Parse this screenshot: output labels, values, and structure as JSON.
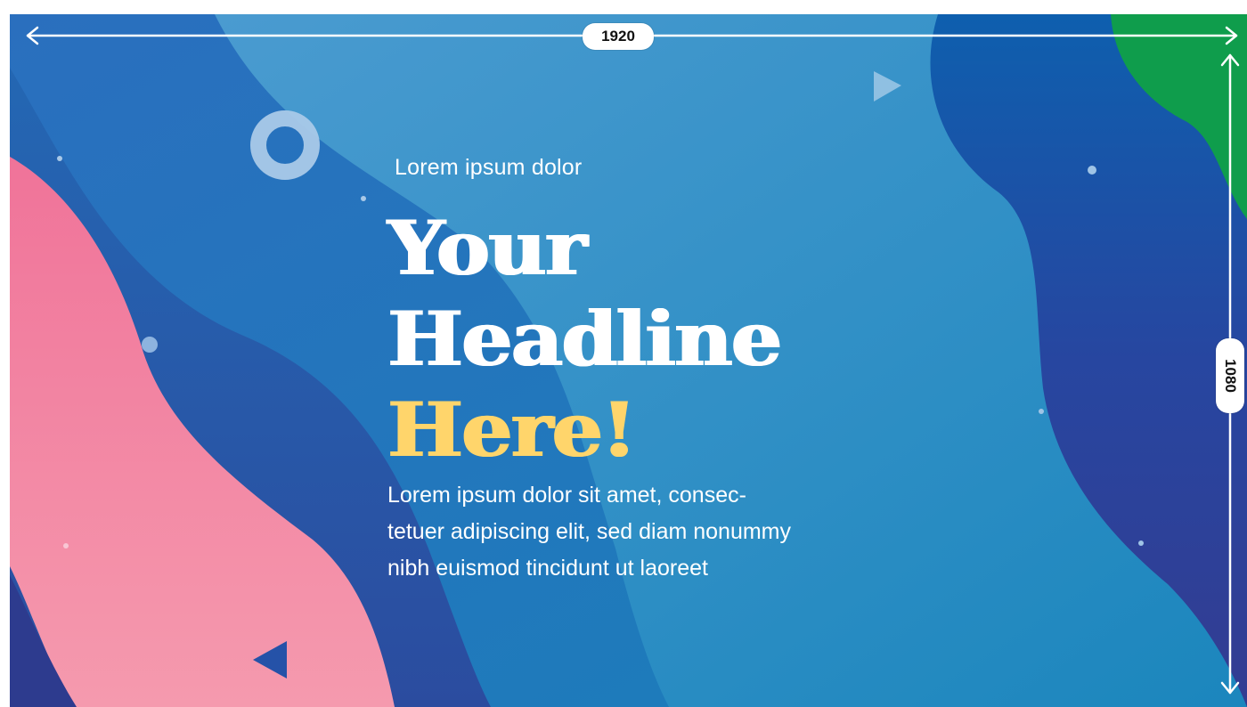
{
  "dimensions": {
    "width_label": "1920",
    "height_label": "1080"
  },
  "content": {
    "kicker": "Lorem ipsum dolor",
    "headline_lines": [
      "Your",
      "Headline",
      "Here!"
    ],
    "body_lines": [
      "Lorem ipsum dolor sit amet, consec-",
      "tetuer adipiscing elit, sed diam nonummy",
      "nibh euismod tincidunt ut laoreet"
    ]
  },
  "colors": {
    "background_blue": "#2a87c4",
    "deep_blue": "#1d5fae",
    "navy": "#2d3b8e",
    "pink": "#f17fa0",
    "green": "#109c4a",
    "headline_accent": "#ffd56b",
    "text": "#ffffff"
  },
  "decorations": {
    "ring": "ring-icon",
    "triangle_right": "play-triangle-icon",
    "triangle_left": "left-triangle-icon",
    "dots": "dot-icon"
  }
}
